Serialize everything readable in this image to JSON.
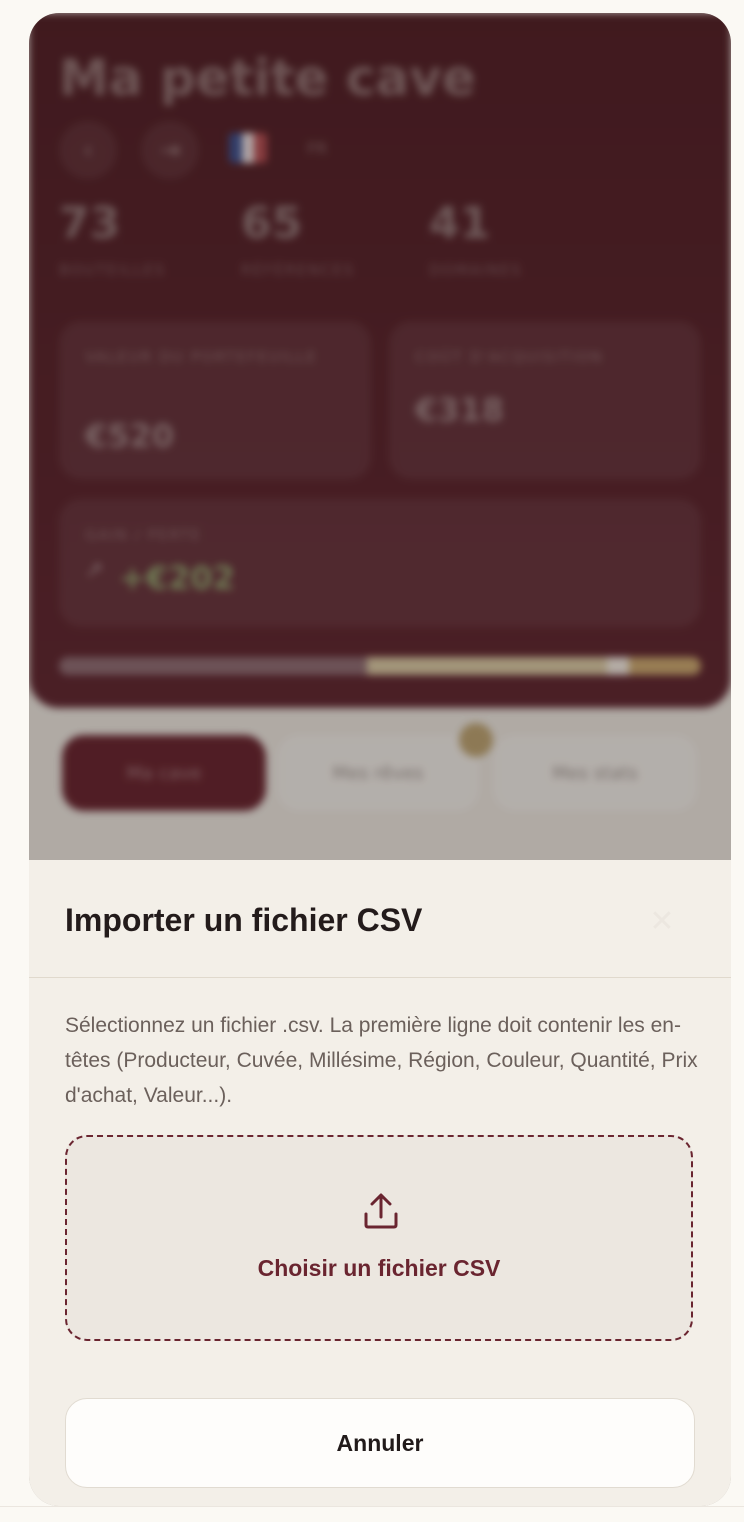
{
  "background_app": {
    "title": "Ma petite cave",
    "flag_code": "FR",
    "stats": [
      {
        "value": "73",
        "label": "BOUTEILLES"
      },
      {
        "value": "65",
        "label": "RÉFÉRENCES"
      },
      {
        "value": "41",
        "label": "DOMAINES"
      }
    ],
    "portfolio_value": {
      "label": "VALEUR DU PORTEFEUILLE",
      "value": "€520"
    },
    "acquisition_cost": {
      "label": "COÛT D'ACQUISITION",
      "value": "€318"
    },
    "gain_loss": {
      "label": "GAIN / PERTE",
      "arrow": "↗",
      "value": "+€202"
    },
    "tabs": [
      "Ma cave",
      "Mes rêves",
      "Mes stats"
    ]
  },
  "sheet": {
    "title": "Importer un fichier CSV",
    "close_symbol": "✕",
    "description": "Sélectionnez un fichier .csv. La première ligne doit contenir les en-têtes (Producteur, Cuvée, Millésime, Région, Couleur, Quantité, Prix d'achat, Valeur...).",
    "choose_file_label": "Choisir un fichier CSV",
    "cancel_label": "Annuler"
  },
  "colors": {
    "brand_burgundy": "#6a2530",
    "sheet_background": "#f3efe8",
    "gain_green": "#8fa06c"
  }
}
